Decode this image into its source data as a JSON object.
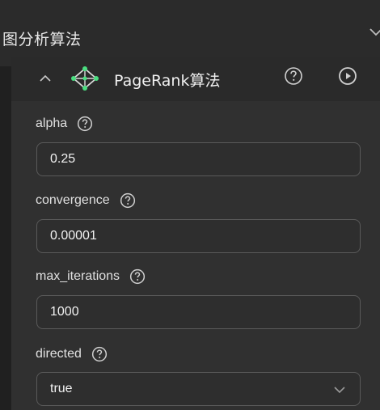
{
  "section": {
    "title": "图分析算法"
  },
  "algorithm": {
    "title": "PageRank算法",
    "collapse_icon": "chevron-up-icon",
    "graph_icon": "graph-network-icon",
    "help_icon": "question-circle-icon",
    "run_icon": "play-circle-icon"
  },
  "params": [
    {
      "label": "alpha",
      "value": "0.25",
      "type": "input"
    },
    {
      "label": "convergence",
      "value": "0.00001",
      "type": "input"
    },
    {
      "label": "max_iterations",
      "value": "1000",
      "type": "input"
    },
    {
      "label": "directed",
      "value": "true",
      "type": "select"
    }
  ],
  "colors": {
    "background": "#202020",
    "header": "#2b2b2b",
    "params_bg": "#303030",
    "border": "#5a5a5a",
    "accent": "#4ade80",
    "text": "#e6e6e6"
  }
}
